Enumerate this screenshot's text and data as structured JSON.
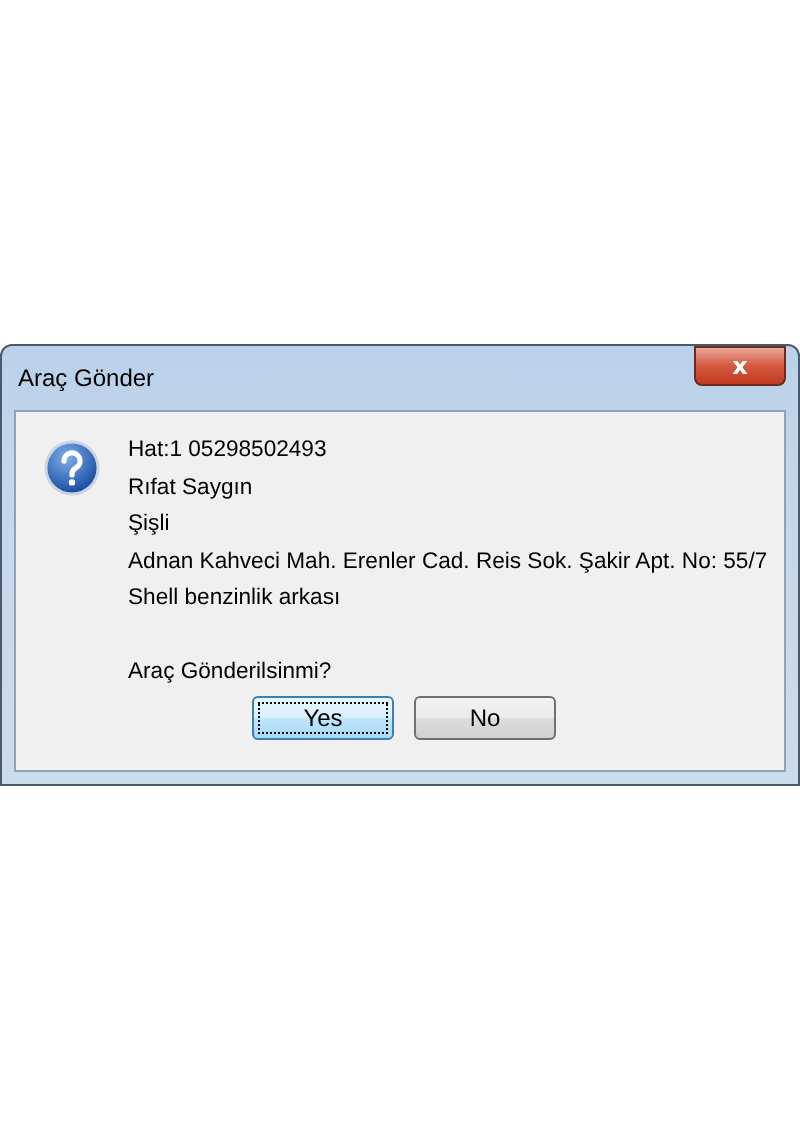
{
  "window": {
    "title": "Araç Gönder",
    "close": "x"
  },
  "message": {
    "lines": [
      "Hat:1 05298502493",
      "Rıfat Saygın",
      "Şişli",
      "Adnan Kahveci Mah. Erenler Cad. Reis Sok. Şakir Apt. No: 55/7",
      "Shell benzinlik arkası"
    ],
    "question": "Araç Gönderilsinmi?"
  },
  "buttons": [
    {
      "label": "Yes",
      "focused": true
    },
    {
      "label": "No",
      "focused": false
    }
  ]
}
